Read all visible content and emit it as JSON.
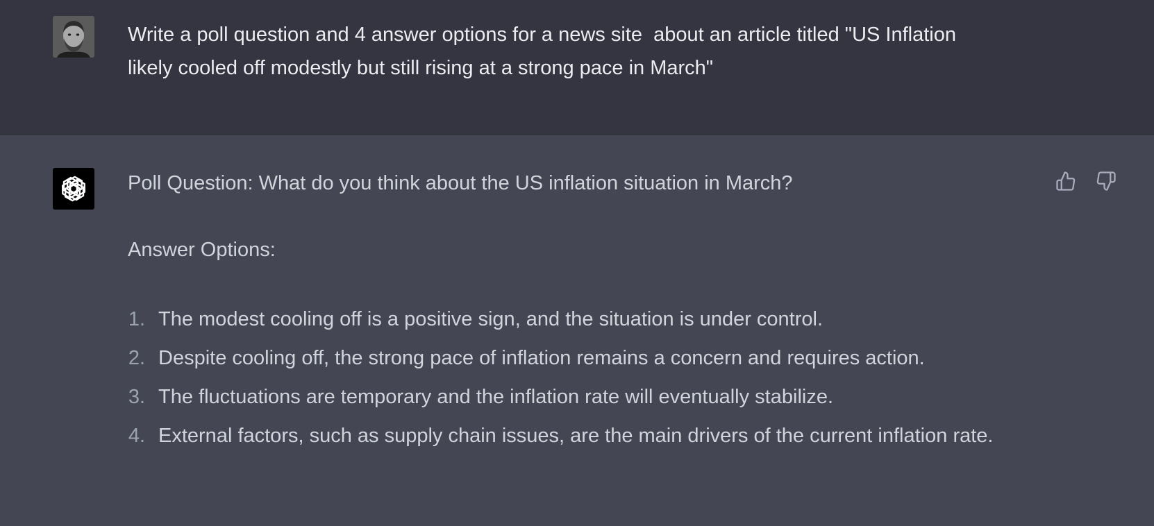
{
  "user_message": {
    "avatar_icon": "user-avatar-photo",
    "text": "Write a poll question and 4 answer options for a news site  about an article titled \"US Inflation likely cooled off modestly but still rising at a strong pace in March\""
  },
  "assistant_message": {
    "avatar_icon": "openai-logo-icon",
    "poll_question": "Poll Question: What do you think about the US inflation situation in March?",
    "answer_options_heading": "Answer Options:",
    "answers": [
      {
        "num": "1.",
        "text": "The modest cooling off is a positive sign, and the situation is under control."
      },
      {
        "num": "2.",
        "text": "Despite cooling off, the strong pace of inflation remains a concern and requires action."
      },
      {
        "num": "3.",
        "text": "The fluctuations are temporary and the inflation rate will eventually stabilize."
      },
      {
        "num": "4.",
        "text": "External factors, such as supply chain issues, are the main drivers of the current inflation rate."
      }
    ],
    "feedback": {
      "thumbs_up_icon": "thumbs-up-icon",
      "thumbs_down_icon": "thumbs-down-icon"
    }
  },
  "colors": {
    "user_bg": "#343541",
    "assistant_bg": "#444654",
    "user_text": "#ececf1",
    "assistant_text": "#d1d5db",
    "list_number": "#9ca3af"
  }
}
